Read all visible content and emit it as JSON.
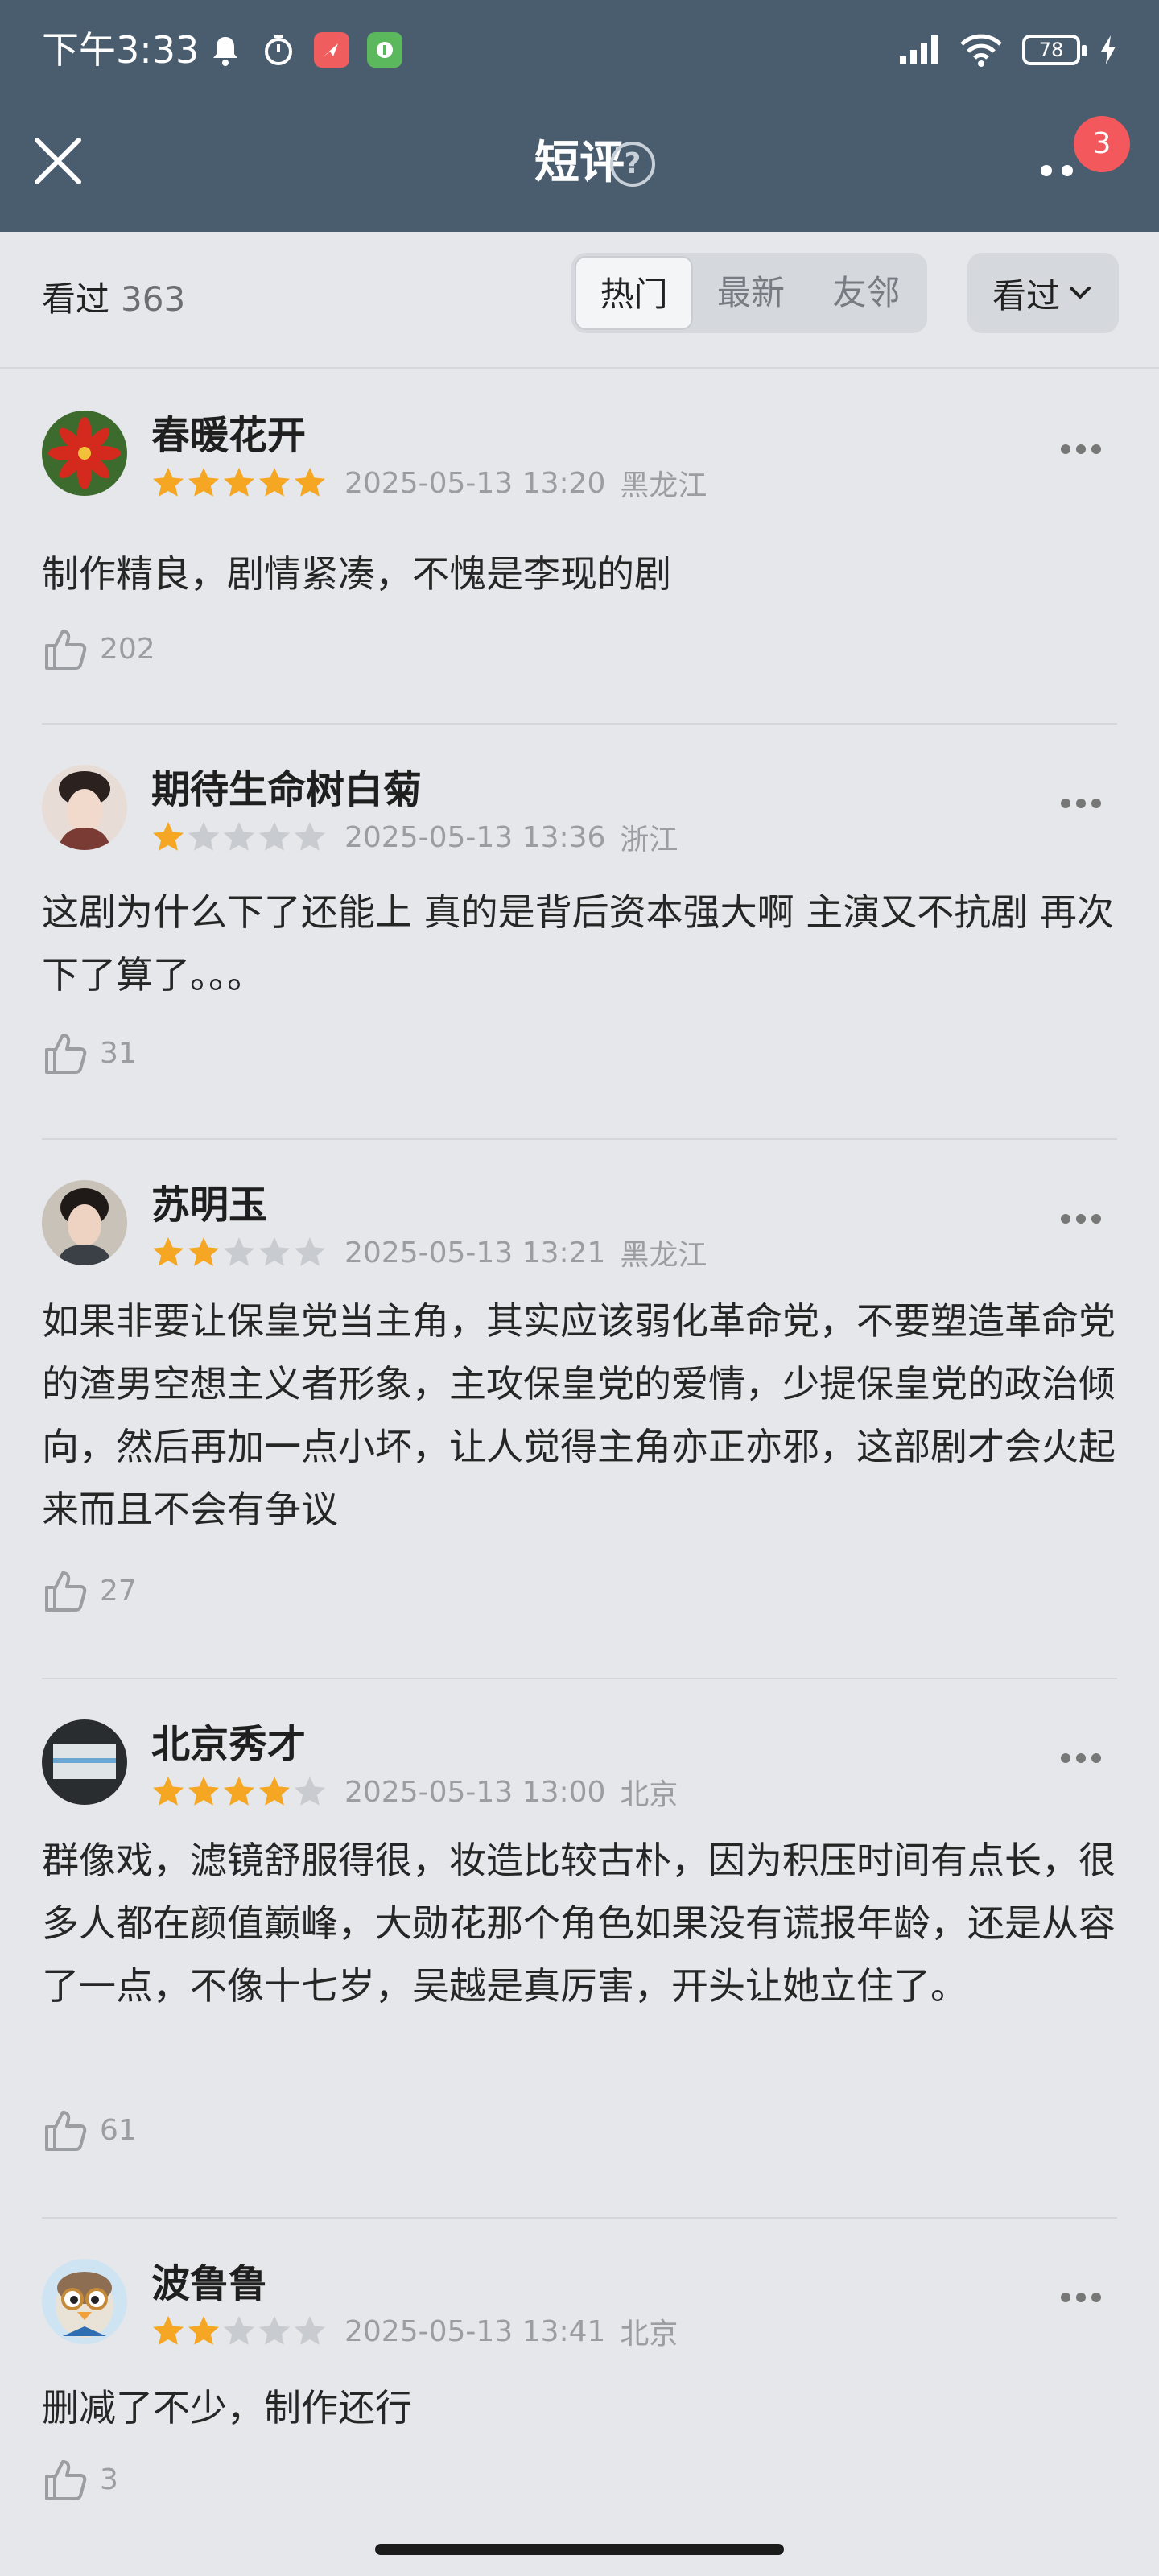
{
  "status_bar": {
    "time": "下午3:33",
    "battery": "78"
  },
  "nav": {
    "title": "短评",
    "help_symbol": "?",
    "badge_count": "3"
  },
  "filter": {
    "watched_label": "看过",
    "watched_count": "363",
    "tabs": [
      {
        "label": "热门",
        "active": true
      },
      {
        "label": "最新",
        "active": false
      },
      {
        "label": "友邻",
        "active": false
      }
    ],
    "dropdown_label": "看过"
  },
  "reviews": [
    {
      "username": "春暖花开",
      "rating": 5,
      "datetime": "2025-05-13 13:20",
      "location": "黑龙江",
      "text": "制作精良，剧情紧凑，不愧是李现的剧",
      "likes": "202",
      "avatar": "red-flower-avatar"
    },
    {
      "username": "期待生命树白菊",
      "rating": 1,
      "datetime": "2025-05-13 13:36",
      "location": "浙江",
      "text": "这剧为什么下了还能上 真的是背后资本强大啊 主演又不抗剧 再次下了算了。。。",
      "likes": "31",
      "avatar": "portrait-avatar"
    },
    {
      "username": "苏明玉",
      "rating": 2,
      "datetime": "2025-05-13 13:21",
      "location": "黑龙江",
      "text": "如果非要让保皇党当主角，其实应该弱化革命党，不要塑造革命党的渣男空想主义者形象，主攻保皇党的爱情，少提保皇党的政治倾向，然后再加一点小坏，让人觉得主角亦正亦邪，这部剧才会火起来而且不会有争议",
      "likes": "27",
      "avatar": "portrait-avatar"
    },
    {
      "username": "北京秀才",
      "rating": 4,
      "datetime": "2025-05-13 13:00",
      "location": "北京",
      "text": "群像戏，滤镜舒服得很，妆造比较古朴，因为积压时间有点长，很多人都在颜值巅峰，大勋花那个角色如果没有谎报年龄，还是从容了一点，不像十七岁，吴越是真厉害，开头让她立住了。",
      "likes": "61",
      "avatar": "window-avatar"
    },
    {
      "username": "波鲁鲁",
      "rating": 2,
      "datetime": "2025-05-13 13:41",
      "location": "北京",
      "text": "删减了不少，制作还行",
      "likes": "3",
      "avatar": "penguin-avatar"
    }
  ],
  "colors": {
    "header_bg": "#4a5d6f",
    "page_bg": "#e5e7ea",
    "star_on": "#f5a623",
    "star_off": "#c8cbcf",
    "badge": "#f3595c"
  }
}
